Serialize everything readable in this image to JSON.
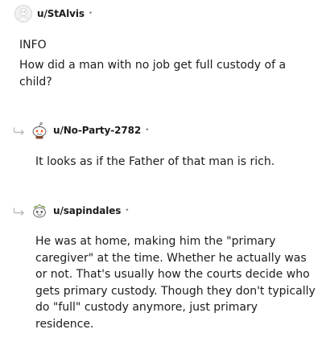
{
  "comments": [
    {
      "username": "u/StAlvis",
      "separator": "•",
      "flair": "INFO",
      "body": "How did a man with no job get full custody of a\nchild?"
    },
    {
      "username": "u/No-Party-2782",
      "separator": "•",
      "body": "It looks as if the Father of that man is rich."
    },
    {
      "username": "u/sapindales",
      "separator": "•",
      "body": "He was at home, making him the \"primary\ncaregiver\" at the time. Whether he actually was\nor not. That's usually how the courts decide who\ngets primary custody. Though they don't typically\ndo \"full\" custody anymore, just primary\nresidence."
    }
  ],
  "icons": {
    "avatar_1": "snoo-avatar-icon",
    "avatar_2": "snoo-avatar-icon",
    "avatar_3": "snoo-avatar-icon",
    "reply": "reply-arrow-icon"
  }
}
